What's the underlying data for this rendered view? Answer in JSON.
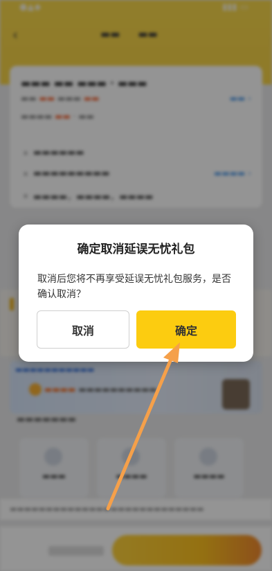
{
  "dialog": {
    "title": "确定取消延误无忧礼包",
    "message": "取消后您将不再享受延误无忧礼包服务，是否确认取消？",
    "cancel_label": "取消",
    "confirm_label": "确定"
  },
  "colors": {
    "accent": "#fccc10",
    "header": "#f6d347",
    "arrow": "#f5a04a",
    "overlay": "rgba(0,0,0,0.42)"
  },
  "icons": {
    "back": "chevron-left-icon",
    "annotation": "arrow-pointer-icon"
  }
}
